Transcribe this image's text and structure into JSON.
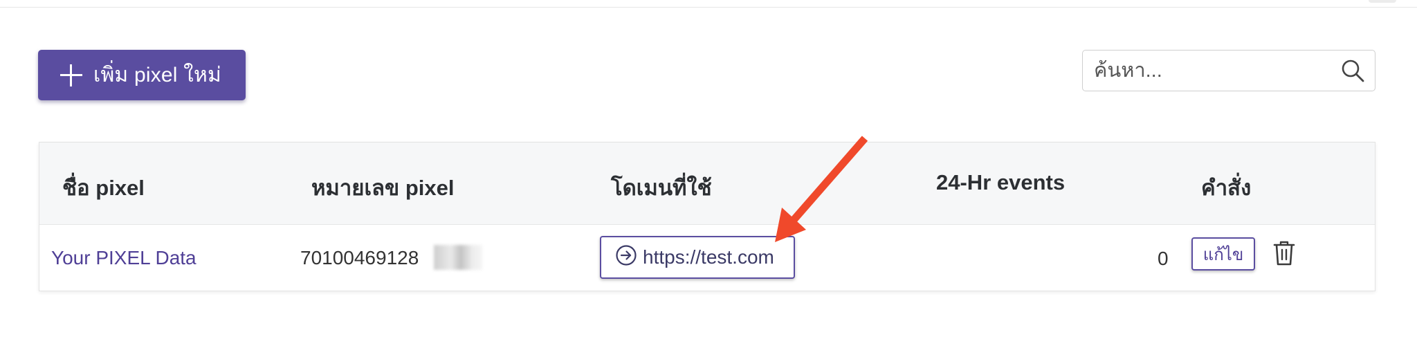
{
  "toolbar": {
    "add_button_label": "เพิ่ม pixel ใหม่",
    "search_placeholder": "ค้นหา..."
  },
  "table": {
    "headers": {
      "name": "ชื่อ pixel",
      "id": "หมายเลข pixel",
      "domain": "โดเมนที่ใช้",
      "events": "24-Hr events",
      "actions": "คำสั่ง"
    },
    "rows": [
      {
        "name": "Your PIXEL Data",
        "pixel_id": "70100469128",
        "domain": "https://test.com",
        "events_24h": "0",
        "edit_label": "แก้ไข"
      }
    ]
  },
  "colors": {
    "primary": "#5a4da0",
    "link": "#4f3f96",
    "annotation_arrow": "#f0492b",
    "header_bg": "#f6f7f8"
  },
  "icons": {
    "add": "plus-icon",
    "search": "search-icon",
    "domain": "circle-arrow-right-icon",
    "delete": "trash-icon",
    "annotation": "red-arrow-annotation"
  }
}
